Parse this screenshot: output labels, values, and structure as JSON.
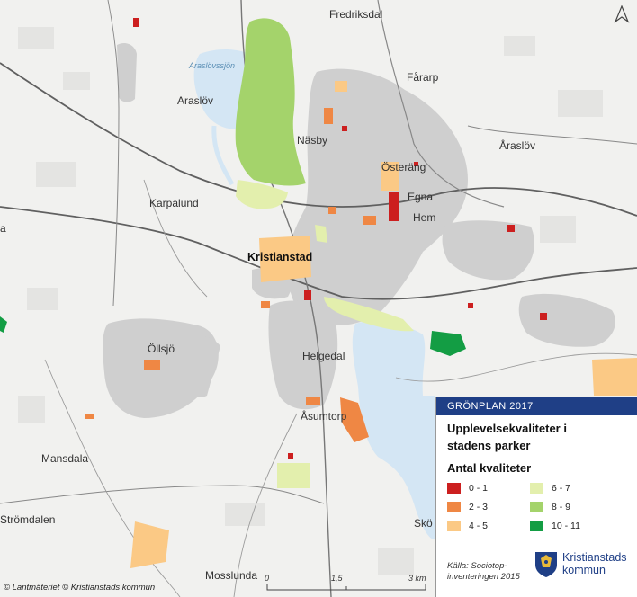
{
  "map": {
    "places": {
      "fredriksdal": "Fredriksdal",
      "fararp": "Fårarp",
      "araslov_w": "Araslöv",
      "araslov_e": "Åraslöv",
      "nasby": "Näsby",
      "osterang": "Österäng",
      "egna": "Egna",
      "hem": "Hem",
      "karpalund": "Karpalund",
      "kristianstad": "Kristianstad",
      "ollsjo": "Öllsjö",
      "helgedal": "Helgedal",
      "asumtorp": "Åsumtorp",
      "mansdala": "Mansdala",
      "stromdalen": "Strömdalen",
      "mosslunda": "Mosslunda",
      "sko": "Skö",
      "edge_a": "a",
      "lake": "Araslövssjön"
    }
  },
  "legend": {
    "header": "GRÖNPLAN 2017",
    "title_line1": "Upplevelsekvaliteter i",
    "title_line2": "stadens parker",
    "subtitle": "Antal kvaliteter",
    "items": [
      {
        "label": "0 - 1",
        "color": "#cc1f1f"
      },
      {
        "label": "2 - 3",
        "color": "#ef8744"
      },
      {
        "label": "4 - 5",
        "color": "#fbc985"
      },
      {
        "label": "6 - 7",
        "color": "#e3efad"
      },
      {
        "label": "8 - 9",
        "color": "#a4d36b"
      },
      {
        "label": "10 - 11",
        "color": "#139d44"
      }
    ],
    "source_line1": "Källa: Sociotop-",
    "source_line2": "inventeringen 2015",
    "logo_line1": "Kristianstads",
    "logo_line2": "kommun"
  },
  "credit": "© Lantmäteriet © Kristianstads kommun",
  "scale": {
    "t0": "0",
    "t1": "1,5",
    "t2": "3 km"
  },
  "colors": {
    "water": "#d6e8f5",
    "built": "#cdcdcd",
    "header": "#1f3f86"
  },
  "north_icon": "north-arrow-icon"
}
